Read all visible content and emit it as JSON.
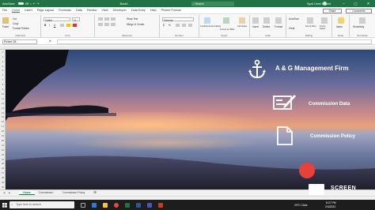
{
  "titlebar": {
    "autosave_label": "AutoSave",
    "autosave_state": "Off",
    "filename": "Book1 -",
    "search_placeholder": "Search",
    "user": "Syed Umer Ahmed",
    "minimize": "–",
    "maximize": "▢",
    "close": "✕"
  },
  "tabs": [
    "File",
    "Home",
    "Insert",
    "Page Layout",
    "Formulas",
    "Data",
    "Review",
    "View",
    "Developer",
    "Data Entry",
    "Help",
    "Picture Format"
  ],
  "tabs_active_index": 1,
  "share_label": "Share",
  "comments_label": "Comments",
  "ribbon": {
    "clipboard": {
      "label": "Clipboard",
      "paste": "Paste",
      "cut": "Cut",
      "copy": "Copy",
      "format_painter": "Format Painter"
    },
    "font": {
      "label": "Font",
      "family": "Calibri",
      "size": "11",
      "bold": "B",
      "italic": "I",
      "underline": "U"
    },
    "alignment": {
      "label": "Alignment",
      "wrap": "Wrap Text",
      "merge": "Merge & Center"
    },
    "number": {
      "label": "Number",
      "format": "General",
      "pct": "%"
    },
    "styles": {
      "label": "Styles",
      "conditional": "Conditional Formatting",
      "table": "Format as Table",
      "cell": "Cell Styles"
    },
    "cells": {
      "label": "Cells",
      "insert": "Insert",
      "delete": "Delete",
      "format": "Format"
    },
    "editing": {
      "label": "Editing",
      "autosum": "AutoSum",
      "clear": "Clear",
      "sort": "Sort & Filter",
      "find": "Find & Select"
    },
    "ideas": {
      "label": "Ideas",
      "ideas": "Ideas"
    },
    "sensitivity": {
      "label": "Sensitivity",
      "sensitivity": "Sensitivity"
    }
  },
  "formula_bar": {
    "name_box": "Picture 3A",
    "fx": "fx"
  },
  "row_numbers": [
    "1",
    "2",
    "3",
    "4",
    "5",
    "6",
    "7",
    "8",
    "9",
    "10",
    "11",
    "12",
    "13",
    "14",
    "15",
    "16",
    "17",
    "18",
    "19",
    "20",
    "21",
    "22",
    "23",
    "24",
    "25",
    "26",
    "27",
    "28",
    "29",
    "30"
  ],
  "picture": {
    "title": "A & G Management Firm",
    "item1": "Commission Data",
    "item2": "Commission Policy",
    "anchor_icon": "anchor-icon",
    "form_icon": "form-edit-icon",
    "document_icon": "document-icon",
    "button_color": "#e8413a"
  },
  "sheet_tabs": [
    "Home",
    "Commission",
    "Commission Policy"
  ],
  "sheet_active_index": 0,
  "taskbar": {
    "search_placeholder": "Type here to search",
    "weather": "29°C  Clear",
    "time": "8:27 PM",
    "date": "2/4/2022"
  },
  "watermark": "SCREEN",
  "colors": {
    "excel_green": "#217346",
    "taskbar": "#1d1d1d"
  }
}
